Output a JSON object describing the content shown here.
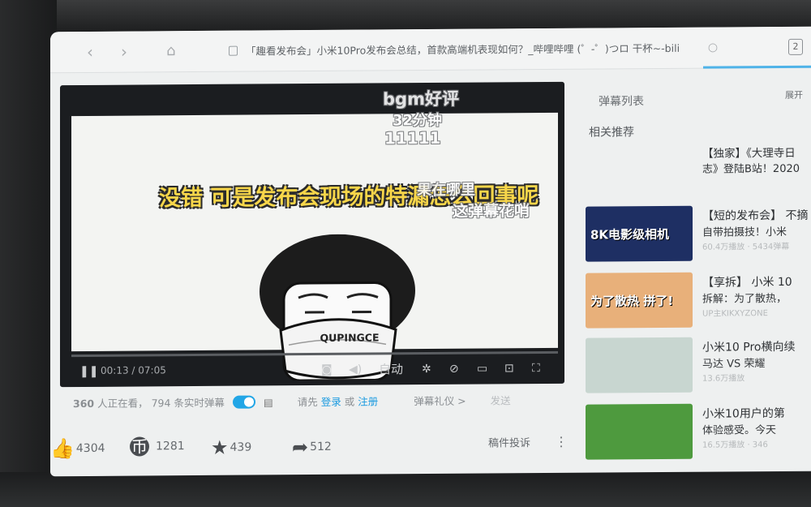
{
  "browser": {
    "url_text": "「趣看发布会」小米10Pro发布会总结，首款高端机表现如何？_哔哩哔哩 (゜-゜)つロ 干杯~-bili",
    "tab_count": "2"
  },
  "player": {
    "subtitle": "没错 可是发布会现场的特漏怎么回事呢",
    "danmaku": [
      "bgm好评",
      "32分钟",
      "11111",
      "果在哪里",
      "这弹幕花哨"
    ],
    "mask_text": "QUPINGCE",
    "time_current": "00:13",
    "time_total": "07:05",
    "quality_label": "自动"
  },
  "info": {
    "viewers": "360",
    "viewers_suffix": "人正在看，",
    "danmaku_count": "794",
    "danmaku_suffix": "条实时弹幕",
    "login_prompt": "请先",
    "login": "登录",
    "or": "或",
    "register": "注册",
    "etiquette": "弹幕礼仪 >",
    "send": "发送"
  },
  "actions": {
    "likes": "4304",
    "coins": "1281",
    "favorites": "439",
    "shares": "512",
    "report": "稿件投诉"
  },
  "sidebar": {
    "danmaku_list": "弹幕列表",
    "expand": "展开",
    "related": "相关推荐",
    "first": {
      "title": "【独家】《大理寺日",
      "sub": "志》登陆B站！2020"
    },
    "items": [
      {
        "title": "【短的发布会】 不摘",
        "sub": "自带拍摄技！小米",
        "meta": "60.4万播放 · 5434弹幕",
        "thumb_text": "8K电影级相机",
        "thumb_color": "#1e2f63"
      },
      {
        "title": "【享拆】 小米 10",
        "sub": "拆解：为了散热，",
        "meta": "UP主KIKXYZONE",
        "thumb_text": "为了散热 拼了!",
        "thumb_color": "#e8b07a"
      },
      {
        "title": "小米10 Pro横向续",
        "sub": "马达 VS 荣耀",
        "meta": "13.6万播放",
        "thumb_text": "",
        "thumb_color": "#c8d6d0"
      },
      {
        "title": "小米10用户的第",
        "sub": "体验感受。今天",
        "meta": "16.5万播放 · 346",
        "thumb_text": "",
        "thumb_color": "#4e9a3e"
      }
    ]
  }
}
